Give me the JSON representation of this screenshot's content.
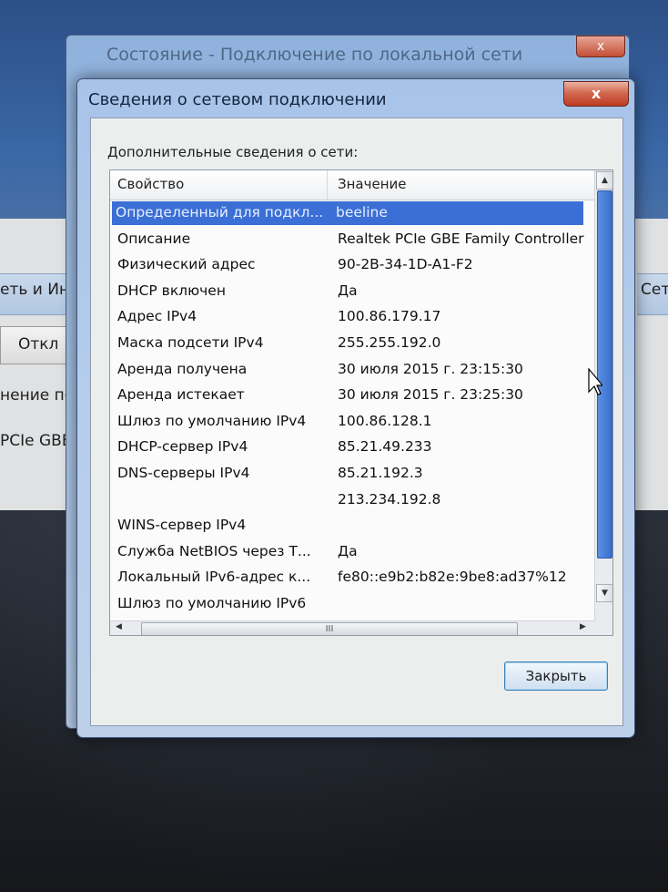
{
  "background": {
    "left_labels": [
      "еть и Инт",
      "Откл",
      "нение по",
      "PCIe GBE F"
    ],
    "right_label": "Сет"
  },
  "back_window": {
    "title": "Состояние - Подключение по локальной сети",
    "close_label": "x"
  },
  "dialog": {
    "title": "Сведения о сетевом подключении",
    "close_label": "x",
    "group_label": "Дополнительные сведения о сети:",
    "columns": {
      "property": "Свойство",
      "value": "Значение"
    },
    "rows": [
      {
        "property": "Определенный для подкл...",
        "value": "beeline",
        "selected": true
      },
      {
        "property": "Описание",
        "value": "Realtek PCIe GBE Family Controller"
      },
      {
        "property": "Физический адрес",
        "value": "90-2B-34-1D-A1-F2"
      },
      {
        "property": "DHCP включен",
        "value": "Да"
      },
      {
        "property": "Адрес IPv4",
        "value": "100.86.179.17"
      },
      {
        "property": "Маска подсети IPv4",
        "value": "255.255.192.0"
      },
      {
        "property": "Аренда получена",
        "value": "30 июля 2015 г. 23:15:30"
      },
      {
        "property": "Аренда истекает",
        "value": "30 июля 2015 г. 23:25:30"
      },
      {
        "property": "Шлюз по умолчанию IPv4",
        "value": "100.86.128.1"
      },
      {
        "property": "DHCP-сервер IPv4",
        "value": "85.21.49.233"
      },
      {
        "property": "DNS-серверы IPv4",
        "value": "85.21.192.3"
      },
      {
        "property": "",
        "value": "213.234.192.8"
      },
      {
        "property": "WINS-сервер IPv4",
        "value": ""
      },
      {
        "property": "Служба NetBIOS через Т...",
        "value": "Да"
      },
      {
        "property": "Локальный IPv6-адрес к...",
        "value": "fe80::e9b2:b82e:9be8:ad37%12"
      },
      {
        "property": "Шлюз по умолчанию IPv6",
        "value": ""
      }
    ],
    "scroll_grip": "III",
    "close_button": "Закрыть"
  }
}
